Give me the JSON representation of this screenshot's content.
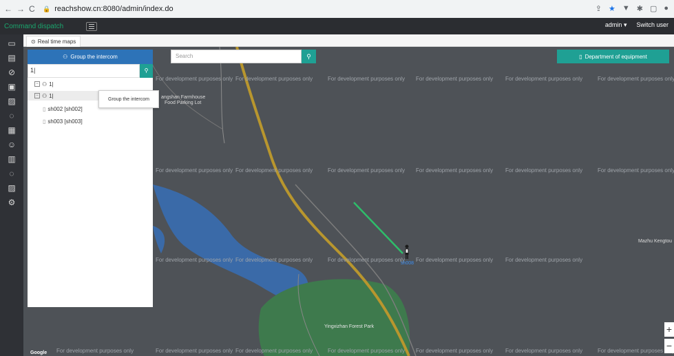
{
  "browser": {
    "back_icon": "←",
    "forward_icon": "→",
    "reload_icon": "C",
    "url": "reachshow.cn:8080/admin/index.do"
  },
  "topbar": {
    "brand": "Command dispatch",
    "user": "admin",
    "switch_user": "Switch user"
  },
  "tab": {
    "label": "Real time maps"
  },
  "panel": {
    "header": "Group the intercom",
    "search_value": "1|",
    "search_icon": "search-icon",
    "tree": [
      {
        "label": "1|",
        "level": 0,
        "expanded": true
      },
      {
        "label": "1|",
        "level": 0,
        "expanded": true,
        "selected": true
      },
      {
        "label": "sh002 [sh002]",
        "level": 1
      },
      {
        "label": "sh003 [sh003]",
        "level": 1
      }
    ],
    "tooltip": "Group the intercom"
  },
  "map_search": {
    "placeholder": "Search"
  },
  "department_button": "Department of equipment",
  "watermark": "For development purposes only",
  "map_labels": {
    "farmhouse": "angshan Farmhouse",
    "parking": "Food Parking Lot",
    "park": "Yingxizhan Forest Park",
    "mazhu": "Mazhu Kengtou",
    "person": "sh008"
  },
  "zoom": {
    "in": "+",
    "out": "−"
  },
  "colors": {
    "topbar_bg": "#2b2d31",
    "brand": "#1aa66e",
    "panel_header": "#2d73b8",
    "teal": "#1fa094",
    "map_bg": "#4e5257",
    "water": "#3a6aa8",
    "park": "#3e7a4d",
    "track": "#2ebd6a"
  }
}
